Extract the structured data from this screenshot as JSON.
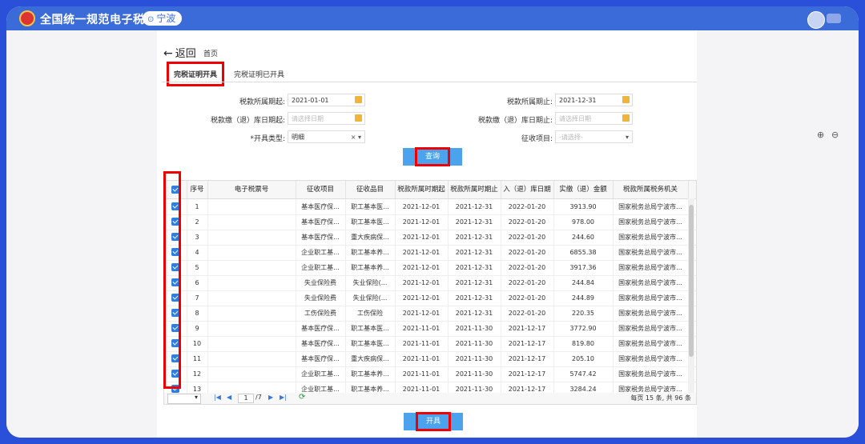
{
  "header": {
    "app_title": "全国统一规范电子税务局",
    "city": "宁波"
  },
  "nav": {
    "back_label": "返回",
    "home_label": "首页"
  },
  "tabs": [
    {
      "label": "完税证明开具",
      "active": true
    },
    {
      "label": "完税证明已开具",
      "active": false
    }
  ],
  "form": {
    "period_start": {
      "label": "税款所属期起:",
      "value": "2021-01-01"
    },
    "period_end": {
      "label": "税款所属期止:",
      "value": "2021-12-31"
    },
    "storage_start": {
      "label": "税款缴（退）库日期起:",
      "placeholder": "请选择日期"
    },
    "storage_end": {
      "label": "税款缴（退）库日期止:",
      "placeholder": "请选择日期"
    },
    "issue_type": {
      "label": "*开具类型:",
      "value": "明细"
    },
    "collection_item": {
      "label": "征收项目:",
      "placeholder": "-请选择-"
    },
    "query_button": "查询"
  },
  "table": {
    "columns": [
      "序号",
      "电子税票号",
      "征收项目",
      "征收品目",
      "税款所属时期起",
      "税款所属时期止",
      "入（退）库日期",
      "实缴（退）金额",
      "税款所属税务机关"
    ],
    "rows": [
      [
        "1",
        "",
        "基本医疗保...",
        "职工基本医...",
        "2021-12-01",
        "2021-12-31",
        "2022-01-20",
        "3913.90",
        "国家税务总局宁波市..."
      ],
      [
        "2",
        "",
        "基本医疗保...",
        "职工基本医...",
        "2021-12-01",
        "2021-12-31",
        "2022-01-20",
        "978.00",
        "国家税务总局宁波市..."
      ],
      [
        "3",
        "",
        "基本医疗保...",
        "重大疾病保...",
        "2021-12-01",
        "2021-12-31",
        "2022-01-20",
        "244.60",
        "国家税务总局宁波市..."
      ],
      [
        "4",
        "",
        "企业职工基...",
        "职工基本养...",
        "2021-12-01",
        "2021-12-31",
        "2022-01-20",
        "6855.38",
        "国家税务总局宁波市..."
      ],
      [
        "5",
        "",
        "企业职工基...",
        "职工基本养...",
        "2021-12-01",
        "2021-12-31",
        "2022-01-20",
        "3917.36",
        "国家税务总局宁波市..."
      ],
      [
        "6",
        "",
        "失业保险费",
        "失业保险(...",
        "2021-12-01",
        "2021-12-31",
        "2022-01-20",
        "244.84",
        "国家税务总局宁波市..."
      ],
      [
        "7",
        "",
        "失业保险费",
        "失业保险(...",
        "2021-12-01",
        "2021-12-31",
        "2022-01-20",
        "244.89",
        "国家税务总局宁波市..."
      ],
      [
        "8",
        "",
        "工伤保险费",
        "工伤保险",
        "2021-12-01",
        "2021-12-31",
        "2022-01-20",
        "220.35",
        "国家税务总局宁波市..."
      ],
      [
        "9",
        "",
        "基本医疗保...",
        "职工基本医...",
        "2021-11-01",
        "2021-11-30",
        "2021-12-17",
        "3772.90",
        "国家税务总局宁波市..."
      ],
      [
        "10",
        "",
        "基本医疗保...",
        "职工基本医...",
        "2021-11-01",
        "2021-11-30",
        "2021-12-17",
        "819.80",
        "国家税务总局宁波市..."
      ],
      [
        "11",
        "",
        "基本医疗保...",
        "重大疾病保...",
        "2021-11-01",
        "2021-11-30",
        "2021-12-17",
        "205.10",
        "国家税务总局宁波市..."
      ],
      [
        "12",
        "",
        "企业职工基...",
        "职工基本养...",
        "2021-11-01",
        "2021-11-30",
        "2021-12-17",
        "5747.42",
        "国家税务总局宁波市..."
      ],
      [
        "13",
        "",
        "企业职工基...",
        "职工基本养...",
        "2021-11-01",
        "2021-11-30",
        "2021-12-17",
        "3284.24",
        "国家税务总局宁波市..."
      ]
    ]
  },
  "pager": {
    "page_value": "1",
    "page_total": "/7",
    "summary": "每页 15 条, 共 96 条"
  },
  "issue_button": "开具"
}
